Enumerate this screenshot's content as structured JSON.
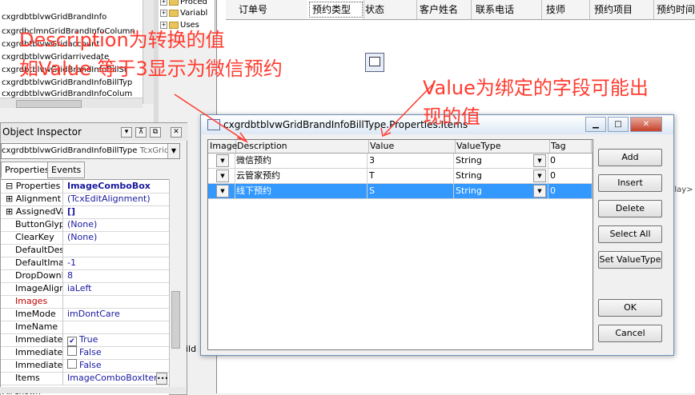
{
  "tree_list": [
    "cxgrdbtblvwGridBrandInfo",
    "cxgrdbclmnGridBrandInfoColumn",
    "cxgrdbtblvwGridaccount",
    "cxgrdbtblvwGridarrivedate",
    "cxgrdbtblvwGridBrandInfoBillSt",
    "cxgrdbtblvwGridBrandInfoBillTyp",
    "cxgrdbtblvwGridBrandInfoColum"
  ],
  "folder_tree": [
    "Proced",
    "Variabl",
    "Uses"
  ],
  "grid_columns": [
    "订单号",
    "预约类型",
    "状态",
    "客户姓名",
    "联系电话",
    "技师",
    "预约项目",
    "预约时间"
  ],
  "object_inspector": {
    "title": "Object Inspector",
    "combo_name": "cxgrdbtblvwGridBrandInfoBillType",
    "combo_type": "TcxGridD",
    "tabs": [
      "Properties",
      "Events"
    ],
    "rows": [
      {
        "name": "Properties",
        "value": "ImageComboBox",
        "exp": "minus"
      },
      {
        "name": "Alignment",
        "value": "(TcxEditAlignment)",
        "exp": "plus"
      },
      {
        "name": "AssignedValu",
        "value": "[]",
        "exp": "plus"
      },
      {
        "name": "ButtonGlyph",
        "value": "(None)"
      },
      {
        "name": "ClearKey",
        "value": "(None)"
      },
      {
        "name": "DefaultDescri",
        "value": ""
      },
      {
        "name": "DefaultImage",
        "value": "-1"
      },
      {
        "name": "DropDownRo",
        "value": "8"
      },
      {
        "name": "ImageAlign",
        "value": "iaLeft"
      },
      {
        "name": "Images",
        "value": ""
      },
      {
        "name": "ImeMode",
        "value": "imDontCare"
      },
      {
        "name": "ImeName",
        "value": ""
      },
      {
        "name": "ImmediateDro",
        "value": "True",
        "check": "✔"
      },
      {
        "name": "ImmediatePo",
        "value": "False",
        "check": ""
      },
      {
        "name": "ImmediateUp",
        "value": "False",
        "check": ""
      },
      {
        "name": "Items",
        "value": "ImageComboBoxItems)"
      }
    ],
    "footer": "All shown"
  },
  "dialog": {
    "title": "cxgrdbtblvwGridBrandInfoBillType.Properties.Items",
    "columns": [
      "Image",
      "Description",
      "Value",
      "ValueType",
      "Tag"
    ],
    "rows": [
      {
        "description": "微信预约",
        "value": "3",
        "value_type": "String",
        "tag": "0"
      },
      {
        "description": "云管家预约",
        "value": "T",
        "value_type": "String",
        "tag": "0"
      },
      {
        "description": "线下预约",
        "value": "S",
        "value_type": "String",
        "tag": "0"
      }
    ],
    "buttons": [
      "Add",
      "Insert",
      "Delete",
      "Select All",
      "Set ValueType",
      "OK",
      "Cancel"
    ]
  },
  "annotations": {
    "line1": "Description为转换的值",
    "line2": "如Value 等于3显示为微信预约",
    "line3": "Value为绑定的字段可能出",
    "line4": "现的值"
  },
  "right_label": "play>",
  "left_fragment": "ild",
  "colors": {
    "annotation": "#ff3b2f",
    "selection": "#3399ff"
  }
}
